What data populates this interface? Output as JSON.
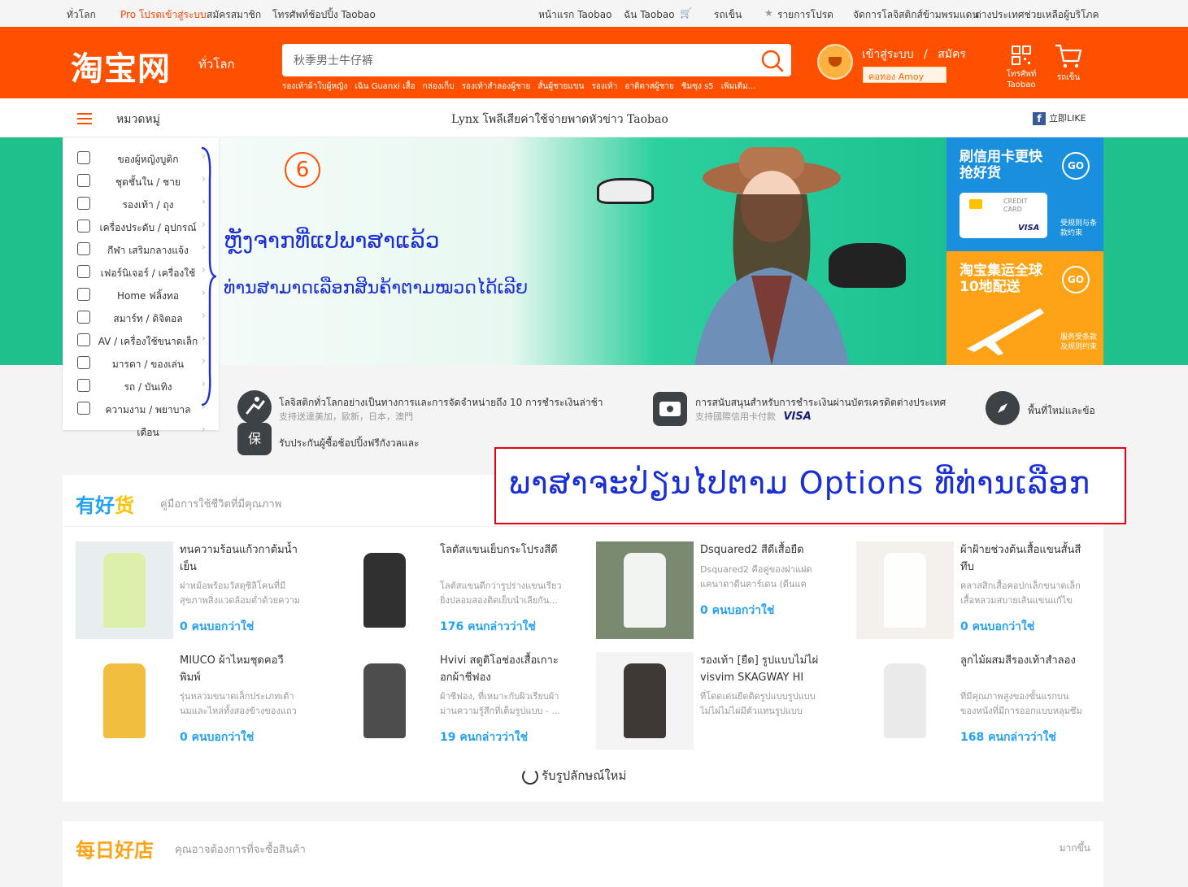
{
  "topbar": {
    "global": "ทั่วโลก",
    "pro_login": "Pro โปรดเข้าสู่ระบบ",
    "register": "สมัครสมาชิก",
    "mobile": "โทรศัพท์ช้อปปิ้ง Taobao",
    "home": "หน้าแรก Taobao",
    "my_taobao": "ฉัน Taobao",
    "cart": "รถเข็น",
    "favorites": "รายการโปรด",
    "logistics": "จัดการโลจิสติกส์ข้ามพรมแดน",
    "help": "ต่างประเทศช่วยเหลือผู้บริโภค"
  },
  "header": {
    "logo": "淘宝网",
    "logo_sub": "ทั่วโลก",
    "search_value": "秋季男士牛仔裤",
    "hot_keywords": [
      "รองเท้าผ้าใบผู้หญิง",
      "เฉิน Guanxi เสื้อ",
      "กล่องเก็บ",
      "รองเท้าสำลองผู้ชาย",
      "สั้นผู้ชายแขน",
      "รองเท้า",
      "อาดิดาสผู้ชาย",
      "ชิมซุง s5",
      "เพิ่มเติม..."
    ],
    "login": "เข้าสู่ระบบ",
    "separator": "/",
    "signup": "สมัคร",
    "amoy": "คอทอง Amoy",
    "mobile_icon_label": "โทรศัพท์",
    "mobile_icon_sub": "Taobao",
    "cart_label": "รถเข็น"
  },
  "catbar": {
    "label": "หมวดหมู่",
    "headline": "Lynx โพลีเสียค่าใช้จ่ายพาดหัวข่าว Taobao",
    "fb": "立即LIKE",
    "fb_glyph": "f"
  },
  "sidebar": {
    "arrow": "›",
    "items": [
      {
        "label": "ของผู้หญิงบูติก",
        "icon": "dress-icon"
      },
      {
        "label": "ชุดชั้นใน / ชาย",
        "icon": "shirt-icon"
      },
      {
        "label": "รองเท้า / ถุง",
        "icon": "bag-icon"
      },
      {
        "label": "เครื่องประดับ / อุปกรณ์",
        "icon": "jewelry-icon"
      },
      {
        "label": "กีฬา เสริมกลางแจ้ง",
        "icon": "shoe-icon"
      },
      {
        "label": "เฟอร์นิเจอร์ / เครื่องใช้",
        "icon": "furniture-icon"
      },
      {
        "label": "Home ฟลิ้งทอ",
        "icon": "umbrella-icon"
      },
      {
        "label": "สมาร์ท / ดิจิตอล",
        "icon": "phone-icon"
      },
      {
        "label": "AV / เครื่องใช้ขนาดเล็ก",
        "icon": "headphone-icon"
      },
      {
        "label": "มารดา / ของเล่น",
        "icon": "toy-icon"
      },
      {
        "label": "รถ / บันเทิง",
        "icon": "car-icon"
      },
      {
        "label": "ความงาม / พยาบาล",
        "icon": "beauty-icon"
      },
      {
        "label": "เดือน",
        "icon": ""
      }
    ]
  },
  "banner": {
    "number": "6",
    "line1": "ຫຼັງຈາກທີ່ແປພາສາແລ້ວ",
    "line2": "ທ່ານສາມາດເລືອກສິນຄ້າຕາມໝວດໄດ້ເລີຍ"
  },
  "promo": {
    "tile1_title": "刷信用卡更快抢好货",
    "tile1_go": "GO",
    "tile1_card_top": "CREDIT",
    "tile1_card_mid": "CARD",
    "tile1_card_brand": "VISA",
    "tile1_small": "受规则与条款约束",
    "tile2_title": "淘宝集运全球10地配送",
    "tile2_go": "GO",
    "tile2_small": "服务受条款及规则约束"
  },
  "services": {
    "s1_title": "โลจิสติกทั่วโลกอย่างเป็นทางการและการจัดจำหน่ายถึง 10 การชำระเงินล่าช้า",
    "s1_sub": "支持送達美加，歐新，日本，澳門",
    "s2_title": "การสนับสนุนสำหรับการชำระเงินผ่านบัตรเครดิตต่างประเทศ",
    "s2_sub": "支持國際信用卡付款",
    "s2_brand": "VISA",
    "s3_title": "พื้นที่ใหม่และข้อ",
    "s4_title": "รับประกันผู้ซื้อช้อปปิ้งฟรีกังวลและ",
    "s4_glyph": "保"
  },
  "annotation": {
    "text": "ພາສາຈະປ່ຽນໄປຕາມ Options ທີ່ທ່ານເລືອກ"
  },
  "goods": {
    "logo_a": "有好",
    "logo_b": "货",
    "subtitle": "คู่มือการใช้ชีวิตที่มีคุณภาพ",
    "refresh": "รับรูปลักษณ์ใหม่",
    "items": [
      {
        "title": "ทนความร้อนแก้วกาต้มน้ำเย็น",
        "desc": "ฝาหม้อพร้อมวัสดุซิลิโคนที่มีสุขภาพสิ่งแวดล้อมต่ำด้วยความดีป...",
        "count": "0 คนบอกว่าใช่"
      },
      {
        "title": "โลตัสแขนเย็บกระโปรงสีดี",
        "desc": "โลตัสแขนดีกว่ารูปร่างแขนเรียวยิ่งปลอมสองติดเย็บนำเลียกัน...",
        "count": "176 คนกล่าวว่าใช่"
      },
      {
        "title": "Dsquared2 สีดีเสื้อยืด",
        "desc": "Dsquared2 คือคู่ของฝาแฝดแคนาดาดีนคาร์เดน (ดีนแคเต้น) แ...",
        "count": "0 คนบอกว่าใช่"
      },
      {
        "title": "ผ้าฝ้ายช่วงต้นเสื้อแขนสั้นสีทึบ",
        "desc": "คลาสสิกเสื้อคอปกเล็กขนาดเล็กเสื้อหลวมสบายเส้นแขนแก้ไขรู้...",
        "count": "0 คนบอกว่าใช่"
      },
      {
        "title": "MIUCO ผ้าไหมชุดคอวีพิมพ์",
        "desc": "รุ่นหลวมขนาดเล็กประเภทเต้านมและไหล่ทั้งสองข้างของแถวเด็...",
        "count": "0 คนบอกว่าใช่"
      },
      {
        "title": "Hvivi สดูดิโอช่องเสื้อเกาะอกผ้าชีฟอง",
        "desc": "ผ้าชีฟอง, ที่เหมาะกับผิวเรียบผ้าม่านความรู้สึกที่เต็มรูปแบบ - ...",
        "count": "19 คนกล่าวว่าใช่"
      },
      {
        "title": "รองเท้า [ยืด] รูปแบบไม่ไผ่ visvim SKAGWAY HI \"ไผ่\"",
        "desc": "ที่โดดเด่นยืดติดรูปแบบรูปแบบไม่ไผ่ไม่ไผ่มีตัวแทนรูปแบบของ...",
        "count": ""
      },
      {
        "title": "ลูกไม้ผสมสีรองเท้าสำลอง",
        "desc": "ที่มีคุณภาพสูงของขั้นแรกบนของหนังที่มีการออกแบบหลุมซึมเพ...",
        "count": "168 คนกล่าวว่าใช่"
      }
    ]
  },
  "shop": {
    "logo": "每日好店",
    "subtitle": "คุณอาจต้องการที่จะซื้อสินค้า",
    "more": "มากขึ้น"
  },
  "colors": {
    "brand_orange": "#ff5000",
    "accent_blue": "#25a1f3",
    "annotation_blue": "#1a2fd6",
    "annotation_red": "#e60012",
    "banner_green": "#1fc08c"
  }
}
